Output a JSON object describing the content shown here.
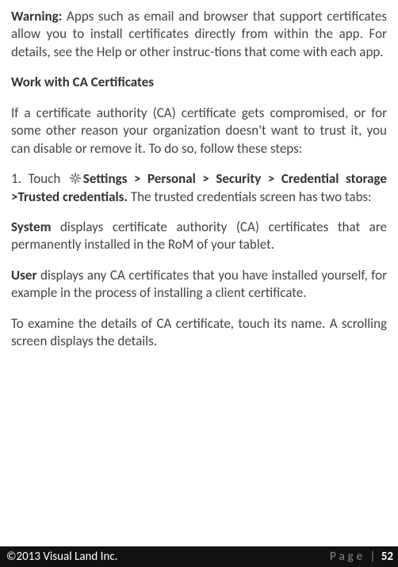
{
  "paragraphs": {
    "warning_label": "Warning:",
    "warning_body": " Apps such as email and browser that support certificates allow you to install certificates directly from within the app. For details, see the Help or other instruc-tions that come with each app.",
    "heading1": "Work with CA Certificates",
    "p1": "If a certificate authority (CA) certificate gets compromised, or for some other reason your organization doesn't want to trust it, you can disable or remove it. To do so, follow these steps:",
    "step1_prefix": "1. Touch  ",
    "step1_bold": "Settings > Personal > Security > Credential storage >Trusted credentials.",
    "step1_tail": " The trusted credentials screen has two tabs:",
    "p_system_label": "System",
    "p_system_body": " displays certificate authority (CA) certificates that are permanently installed in the RoM of your tablet.",
    "p_user_label": "User",
    "p_user_body": " displays any CA certificates that you have installed yourself, for example in the process of installing a client certificate.",
    "p_final": "To examine the details of CA certificate, touch its name. A scrolling screen displays the details."
  },
  "footer": {
    "copyright": "©2013 Visual Land Inc.",
    "page_label": "Page",
    "sep": "|",
    "page_num": "52"
  }
}
